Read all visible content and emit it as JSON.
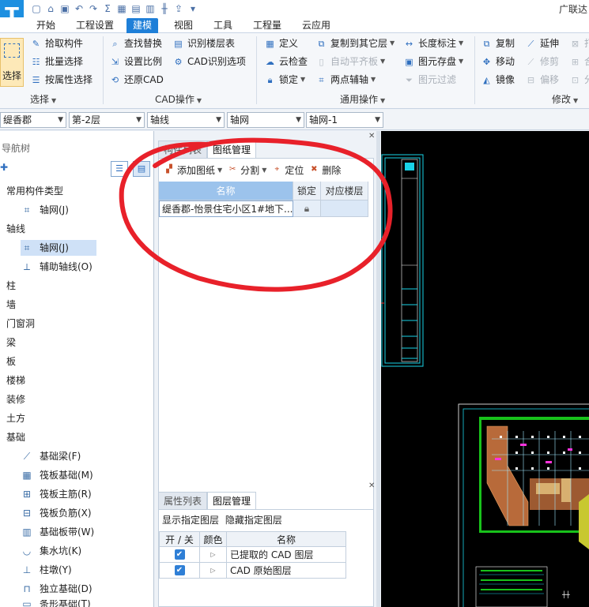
{
  "app": {
    "logo_text": "T",
    "brand": "广联达"
  },
  "menu": {
    "tabs": [
      {
        "label": "开始"
      },
      {
        "label": "工程设置"
      },
      {
        "label": "建模"
      },
      {
        "label": "视图"
      },
      {
        "label": "工具"
      },
      {
        "label": "工程量"
      },
      {
        "label": "云应用"
      }
    ],
    "active": "建模"
  },
  "ribbon": {
    "select_big": "选择",
    "select_group": {
      "items": [
        "拾取构件",
        "批量选择",
        "按属性选择"
      ],
      "label": "选择"
    },
    "cad_group": {
      "col1": [
        "查找替换",
        "设置比例",
        "还原CAD"
      ],
      "col2": [
        "识别楼层表",
        "CAD识别选项"
      ],
      "label": "CAD操作"
    },
    "common_group": {
      "col1": [
        "定义",
        "云检查",
        "锁定"
      ],
      "col2": [
        "复制到其它层",
        "自动平齐板",
        "两点辅轴"
      ],
      "col3": [
        "长度标注",
        "图元存盘",
        "图元过滤"
      ],
      "label": "通用操作"
    },
    "modify_group": {
      "col1": [
        "复制",
        "移动",
        "镜像"
      ],
      "col2": [
        "延伸",
        "修剪",
        "偏移"
      ],
      "col3": [
        "打",
        "合",
        "分"
      ],
      "label": "修改"
    }
  },
  "filter": {
    "project": "缇香郡",
    "floor": "第-2层",
    "category": "轴线",
    "type": "轴网",
    "instance": "轴网-1"
  },
  "nav": {
    "header": "导航树",
    "tree": [
      {
        "label": "常用构件类型",
        "level": 0
      },
      {
        "label": "轴网(J)",
        "level": 1,
        "icon": "grid-icon"
      },
      {
        "label": "轴线",
        "level": 0
      },
      {
        "label": "轴网(J)",
        "level": 1,
        "icon": "grid-icon",
        "selected": true
      },
      {
        "label": "辅助轴线(O)",
        "level": 1,
        "icon": "aux-axis-icon"
      },
      {
        "label": "柱",
        "level": 0
      },
      {
        "label": "墙",
        "level": 0
      },
      {
        "label": "门窗洞",
        "level": 0
      },
      {
        "label": "梁",
        "level": 0
      },
      {
        "label": "板",
        "level": 0
      },
      {
        "label": "楼梯",
        "level": 0
      },
      {
        "label": "装修",
        "level": 0
      },
      {
        "label": "土方",
        "level": 0
      },
      {
        "label": "基础",
        "level": 0
      },
      {
        "label": "基础梁(F)",
        "level": 1,
        "icon": "foundation-beam-icon"
      },
      {
        "label": "筏板基础(M)",
        "level": 1,
        "icon": "raft-icon"
      },
      {
        "label": "筏板主筋(R)",
        "level": 1,
        "icon": "raft-main-rebar-icon"
      },
      {
        "label": "筏板负筋(X)",
        "level": 1,
        "icon": "raft-neg-rebar-icon"
      },
      {
        "label": "基础板带(W)",
        "level": 1,
        "icon": "slab-strip-icon"
      },
      {
        "label": "集水坑(K)",
        "level": 1,
        "icon": "sump-icon"
      },
      {
        "label": "柱墩(Y)",
        "level": 1,
        "icon": "pier-icon"
      },
      {
        "label": "独立基础(D)",
        "level": 1,
        "icon": "isolated-footing-icon"
      },
      {
        "label": "条形基础(T)",
        "level": 1,
        "icon": "strip-footing-icon"
      }
    ]
  },
  "drawing_panel": {
    "tabs": [
      "构件列表",
      "图纸管理"
    ],
    "active_tab": "图纸管理",
    "toolbar": [
      "添加图纸",
      "分割",
      "定位",
      "删除"
    ],
    "columns": [
      "名称",
      "锁定",
      "对应楼层"
    ],
    "rows": [
      {
        "name": "缇香郡-怡景住宅小区1#地下...",
        "locked": "",
        "floor": ""
      }
    ]
  },
  "layer_panel": {
    "tabs": [
      "属性列表",
      "图层管理"
    ],
    "active_tab": "图层管理",
    "links": [
      "显示指定图层",
      "隐藏指定图层"
    ],
    "columns": [
      "开 / 关",
      "颜色",
      "名称"
    ],
    "rows": [
      {
        "on": true,
        "name": "已提取的 CAD 图层"
      },
      {
        "on": true,
        "name": "CAD 原始图层"
      }
    ]
  },
  "colors": {
    "accent": "#1e7fd8",
    "annotation": "#e8212a",
    "cad_background": "#000000"
  }
}
